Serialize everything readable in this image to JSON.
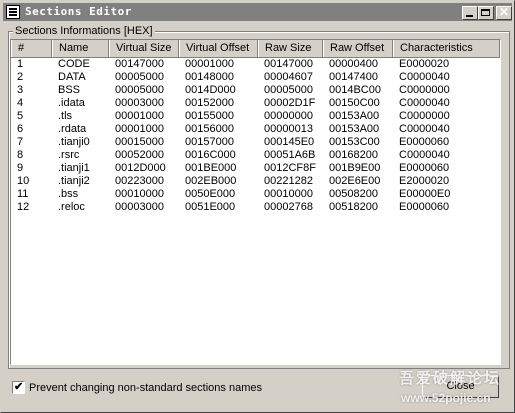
{
  "window": {
    "title": "Sections Editor",
    "minimize_icon": "minimize-icon",
    "maximize_icon": "maximize-icon",
    "close_symbol": "✕"
  },
  "group": {
    "label": "Sections Informations [HEX]"
  },
  "table": {
    "columns": [
      "#",
      "Name",
      "Virtual Size",
      "Virtual Offset",
      "Raw Size",
      "Raw Offset",
      "Characteristics"
    ],
    "rows": [
      [
        "1",
        "CODE",
        "00147000",
        "00001000",
        "00147000",
        "00000400",
        "E0000020"
      ],
      [
        "2",
        "DATA",
        "00005000",
        "00148000",
        "00004607",
        "00147400",
        "C0000040"
      ],
      [
        "3",
        "BSS",
        "00005000",
        "0014D000",
        "00005000",
        "0014BC00",
        "C0000000"
      ],
      [
        "4",
        ".idata",
        "00003000",
        "00152000",
        "00002D1F",
        "00150C00",
        "C0000040"
      ],
      [
        "5",
        ".tls",
        "00001000",
        "00155000",
        "00000000",
        "00153A00",
        "C0000000"
      ],
      [
        "6",
        ".rdata",
        "00001000",
        "00156000",
        "00000013",
        "00153A00",
        "C0000040"
      ],
      [
        "7",
        ".tianji0",
        "00015000",
        "00157000",
        "000145E0",
        "00153C00",
        "E0000060"
      ],
      [
        "8",
        ".rsrc",
        "00052000",
        "0016C000",
        "00051A6B",
        "00168200",
        "C0000040"
      ],
      [
        "9",
        ".tianji1",
        "0012D000",
        "001BE000",
        "0012CF8F",
        "001B9E00",
        "E0000060"
      ],
      [
        "10",
        ".tianji2",
        "00223000",
        "002EB000",
        "00221282",
        "002E6E00",
        "E2000020"
      ],
      [
        "11",
        ".bss",
        "00010000",
        "0050E000",
        "00010000",
        "00508200",
        "E00000E0"
      ],
      [
        "12",
        ".reloc",
        "00003000",
        "0051E000",
        "00002768",
        "00518200",
        "E0000060"
      ]
    ]
  },
  "options": {
    "prevent_label": "Prevent changing non-standard sections names",
    "prevent_checked": true,
    "check_mark": "✔"
  },
  "buttons": {
    "close_label": "Close"
  },
  "watermark": {
    "text": "吾爱破解论坛",
    "url": "www.52pojie.cn"
  },
  "colors": {
    "titlebar": "#808080",
    "face": "#d4d0c8"
  }
}
